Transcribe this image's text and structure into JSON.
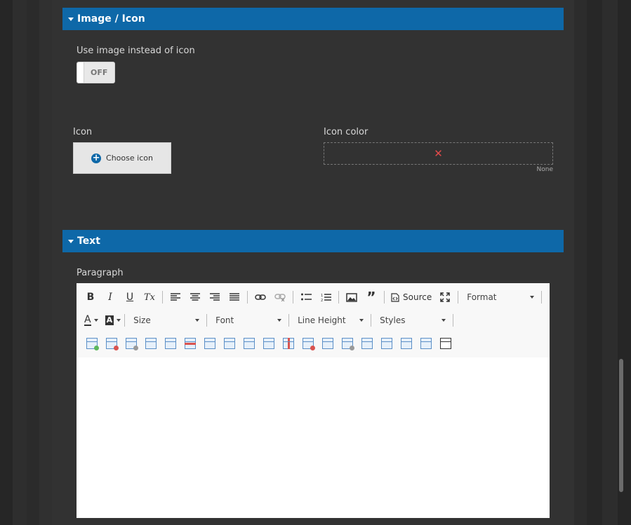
{
  "sections": {
    "image_icon": {
      "title": "Image / Icon"
    },
    "text": {
      "title": "Text"
    }
  },
  "image_icon": {
    "use_image_label": "Use image instead of icon",
    "toggle_state": "OFF",
    "icon_label": "Icon",
    "choose_icon_label": "Choose icon",
    "icon_color_label": "Icon color",
    "icon_color_value": "None",
    "clear_symbol": "✕"
  },
  "text": {
    "paragraph_label": "Paragraph"
  },
  "toolbar": {
    "bold": "B",
    "italic": "I",
    "underline": "U",
    "remove_format": "Tx",
    "source": "Source",
    "format": "Format",
    "size": "Size",
    "font": "Font",
    "line_height": "Line Height",
    "styles": "Styles",
    "text_color": "A",
    "bg_color": "A"
  },
  "colors": {
    "accent": "#0e68a8",
    "panel": "#323232",
    "clear_red": "#e04a4a"
  }
}
